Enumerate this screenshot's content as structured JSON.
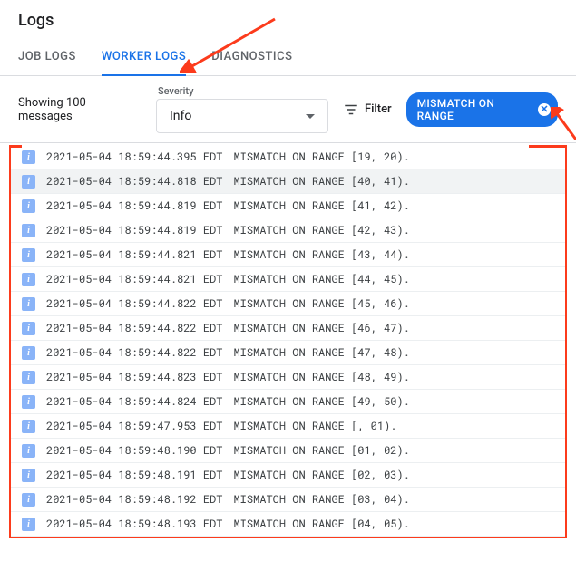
{
  "header": {
    "title": "Logs"
  },
  "tabs": {
    "items": [
      {
        "label": "JOB LOGS",
        "active": false
      },
      {
        "label": "WORKER LOGS",
        "active": true
      },
      {
        "label": "DIAGNOSTICS",
        "active": false
      }
    ]
  },
  "controls": {
    "showing": "Showing 100 messages",
    "severity_label": "Severity",
    "severity_value": "Info",
    "filter_label": "Filter",
    "chip_label": "MISMATCH ON RANGE"
  },
  "logs": [
    {
      "ts": "2021-05-04 18:59:44.395 EDT",
      "msg": "MISMATCH ON RANGE [19, 20)."
    },
    {
      "ts": "2021-05-04 18:59:44.818 EDT",
      "msg": "MISMATCH ON RANGE [40, 41)."
    },
    {
      "ts": "2021-05-04 18:59:44.819 EDT",
      "msg": "MISMATCH ON RANGE [41, 42)."
    },
    {
      "ts": "2021-05-04 18:59:44.819 EDT",
      "msg": "MISMATCH ON RANGE [42, 43)."
    },
    {
      "ts": "2021-05-04 18:59:44.821 EDT",
      "msg": "MISMATCH ON RANGE [43, 44)."
    },
    {
      "ts": "2021-05-04 18:59:44.821 EDT",
      "msg": "MISMATCH ON RANGE [44, 45)."
    },
    {
      "ts": "2021-05-04 18:59:44.822 EDT",
      "msg": "MISMATCH ON RANGE [45, 46)."
    },
    {
      "ts": "2021-05-04 18:59:44.822 EDT",
      "msg": "MISMATCH ON RANGE [46, 47)."
    },
    {
      "ts": "2021-05-04 18:59:44.822 EDT",
      "msg": "MISMATCH ON RANGE [47, 48)."
    },
    {
      "ts": "2021-05-04 18:59:44.823 EDT",
      "msg": "MISMATCH ON RANGE [48, 49)."
    },
    {
      "ts": "2021-05-04 18:59:44.824 EDT",
      "msg": "MISMATCH ON RANGE [49, 50)."
    },
    {
      "ts": "2021-05-04 18:59:47.953 EDT",
      "msg": "MISMATCH ON RANGE [, 01)."
    },
    {
      "ts": "2021-05-04 18:59:48.190 EDT",
      "msg": "MISMATCH ON RANGE [01, 02)."
    },
    {
      "ts": "2021-05-04 18:59:48.191 EDT",
      "msg": "MISMATCH ON RANGE [02, 03)."
    },
    {
      "ts": "2021-05-04 18:59:48.192 EDT",
      "msg": "MISMATCH ON RANGE [03, 04)."
    },
    {
      "ts": "2021-05-04 18:59:48.193 EDT",
      "msg": "MISMATCH ON RANGE [04, 05)."
    }
  ],
  "colors": {
    "accent": "#1a73e8",
    "highlight": "#fc3b1c",
    "info_icon": "#8ab4f8"
  }
}
